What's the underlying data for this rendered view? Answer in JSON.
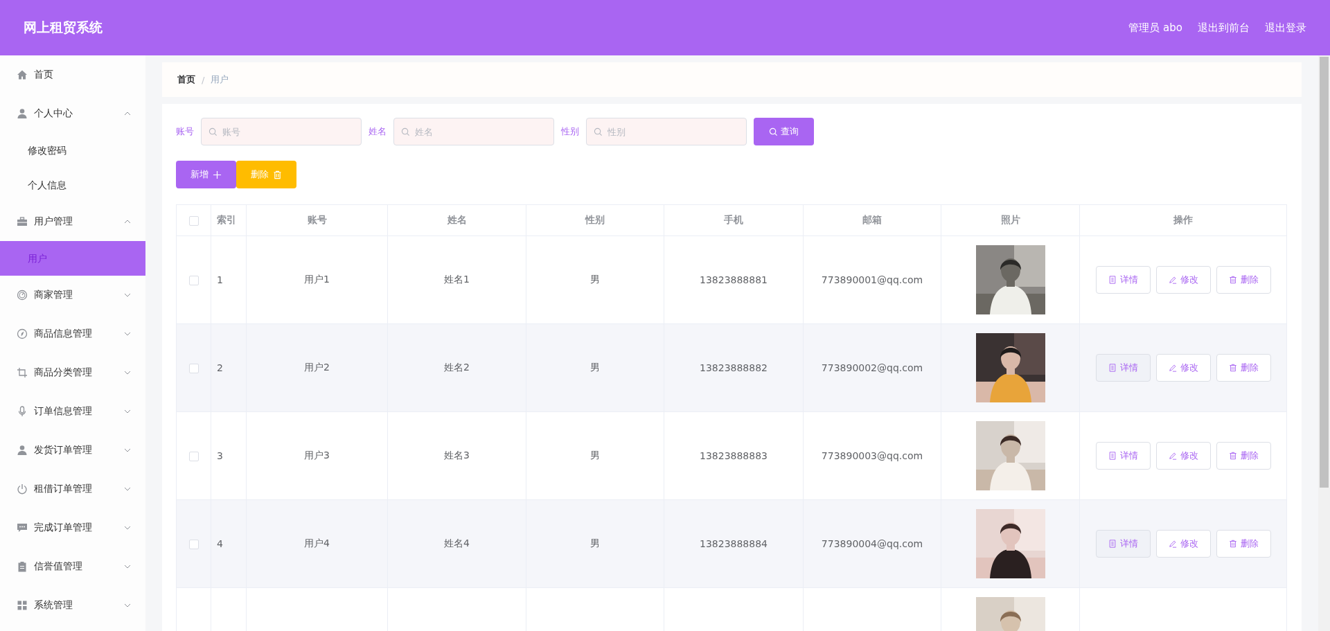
{
  "header": {
    "title": "网上租贸系统",
    "links": [
      "管理员 abo",
      "退出到前台",
      "退出登录"
    ]
  },
  "sidebar": {
    "items": [
      {
        "label": "首页",
        "kind": "link"
      },
      {
        "label": "个人中心",
        "kind": "menu",
        "expanded": true,
        "children": [
          {
            "label": "修改密码",
            "selected": false
          },
          {
            "label": "个人信息",
            "selected": false
          }
        ]
      },
      {
        "label": "用户管理",
        "kind": "menu",
        "expanded": true,
        "children": [
          {
            "label": "用户",
            "selected": true
          }
        ]
      },
      {
        "label": "商家管理",
        "kind": "menu",
        "expanded": false
      },
      {
        "label": "商品信息管理",
        "kind": "menu",
        "expanded": false
      },
      {
        "label": "商品分类管理",
        "kind": "menu",
        "expanded": false
      },
      {
        "label": "订单信息管理",
        "kind": "menu",
        "expanded": false
      },
      {
        "label": "发货订单管理",
        "kind": "menu",
        "expanded": false
      },
      {
        "label": "租借订单管理",
        "kind": "menu",
        "expanded": false
      },
      {
        "label": "完成订单管理",
        "kind": "menu",
        "expanded": false
      },
      {
        "label": "信誉值管理",
        "kind": "menu",
        "expanded": false
      },
      {
        "label": "系统管理",
        "kind": "menu",
        "expanded": false
      }
    ]
  },
  "breadcrumb": [
    "首页",
    "用户"
  ],
  "breadcrumb_separator": "/",
  "search": {
    "fields": [
      {
        "label": "账号",
        "placeholder": "账号"
      },
      {
        "label": "姓名",
        "placeholder": "姓名"
      },
      {
        "label": "性别",
        "placeholder": "性别"
      }
    ],
    "button": "查询"
  },
  "actions": [
    {
      "label": "新增",
      "kind": "add"
    },
    {
      "label": "删除",
      "kind": "delete"
    }
  ],
  "table": {
    "select_all": {
      "checked": false
    },
    "columns": [
      "索引",
      "账号",
      "姓名",
      "性别",
      "手机",
      "邮箱",
      "照片",
      "操作"
    ],
    "rows": [
      {
        "checked": false,
        "cells": [
          "1",
          "用户1",
          "姓名1",
          "男",
          "13823888881",
          "773890001@qq.com"
        ],
        "photo": {
          "kind": "picture"
        },
        "buttons": [
          "详情",
          "修改",
          "删除"
        ]
      },
      {
        "checked": false,
        "cells": [
          "2",
          "用户2",
          "姓名2",
          "男",
          "13823888882",
          "773890002@qq.com"
        ],
        "photo": {
          "kind": "picture"
        },
        "buttons": [
          "详情",
          "修改",
          "删除"
        ]
      },
      {
        "checked": false,
        "cells": [
          "3",
          "用户3",
          "姓名3",
          "男",
          "13823888883",
          "773890003@qq.com"
        ],
        "photo": {
          "kind": "picture"
        },
        "buttons": [
          "详情",
          "修改",
          "删除"
        ]
      },
      {
        "checked": false,
        "cells": [
          "4",
          "用户4",
          "姓名4",
          "男",
          "13823888884",
          "773890004@qq.com"
        ],
        "photo": {
          "kind": "picture"
        },
        "buttons": [
          "详情",
          "修改",
          "删除"
        ]
      },
      {
        "photo": {
          "kind": "picture"
        }
      }
    ]
  }
}
